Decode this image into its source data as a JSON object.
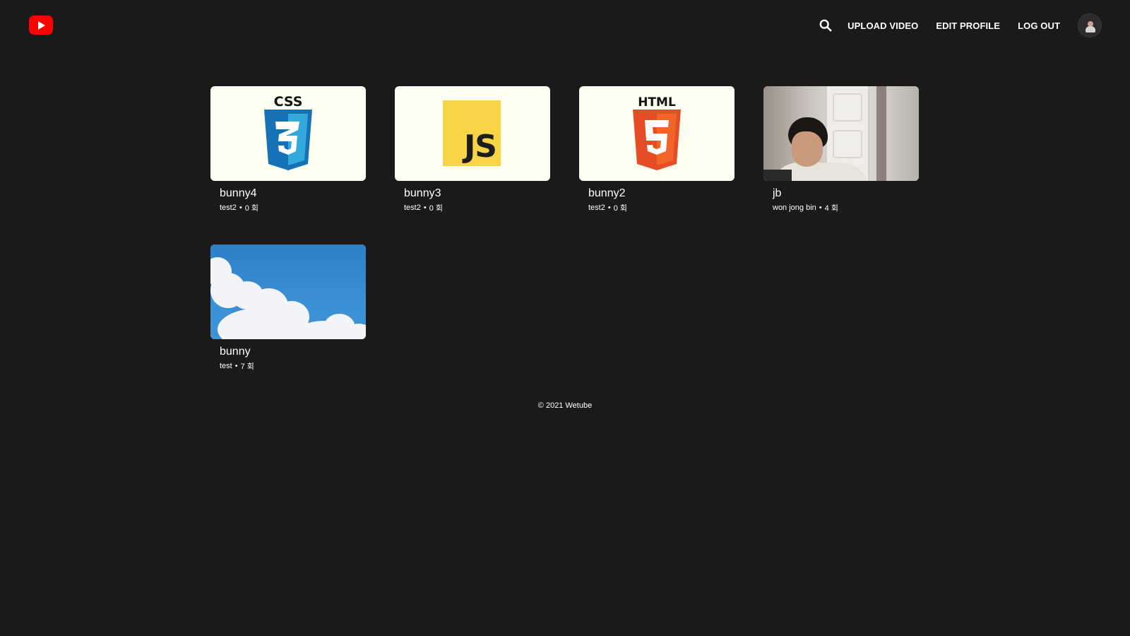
{
  "header": {
    "logo_icon": "youtube-play-icon",
    "search_icon": "search-icon",
    "nav": {
      "upload_label": "UPLOAD VIDEO",
      "edit_label": "EDIT PROFILE",
      "logout_label": "LOG OUT"
    },
    "avatar_icon": "user-avatar"
  },
  "videos": [
    {
      "title": "bunny4",
      "owner": "test2",
      "views": "0 회",
      "thumbnail": "css3-logo"
    },
    {
      "title": "bunny3",
      "owner": "test2",
      "views": "0 회",
      "thumbnail": "js-logo"
    },
    {
      "title": "bunny2",
      "owner": "test2",
      "views": "0 회",
      "thumbnail": "html5-logo"
    },
    {
      "title": "jb",
      "owner": "won jong bin",
      "views": "4 회",
      "thumbnail": "webcam-photo"
    },
    {
      "title": "bunny",
      "owner": "test",
      "views": "7 회",
      "thumbnail": "sky-clouds-photo"
    }
  ],
  "separator": "•",
  "thumbnail_text": {
    "css": "CSS",
    "html": "HTML",
    "js": "JS"
  },
  "footer": {
    "text": "© 2021 Wetube"
  },
  "colors": {
    "background": "#1a1a1b",
    "logo_red": "#ff0000",
    "thumb_bg": "#fffff2",
    "css_blue": "#1572b6",
    "html_orange": "#e44d26",
    "js_yellow": "#f7d546"
  }
}
